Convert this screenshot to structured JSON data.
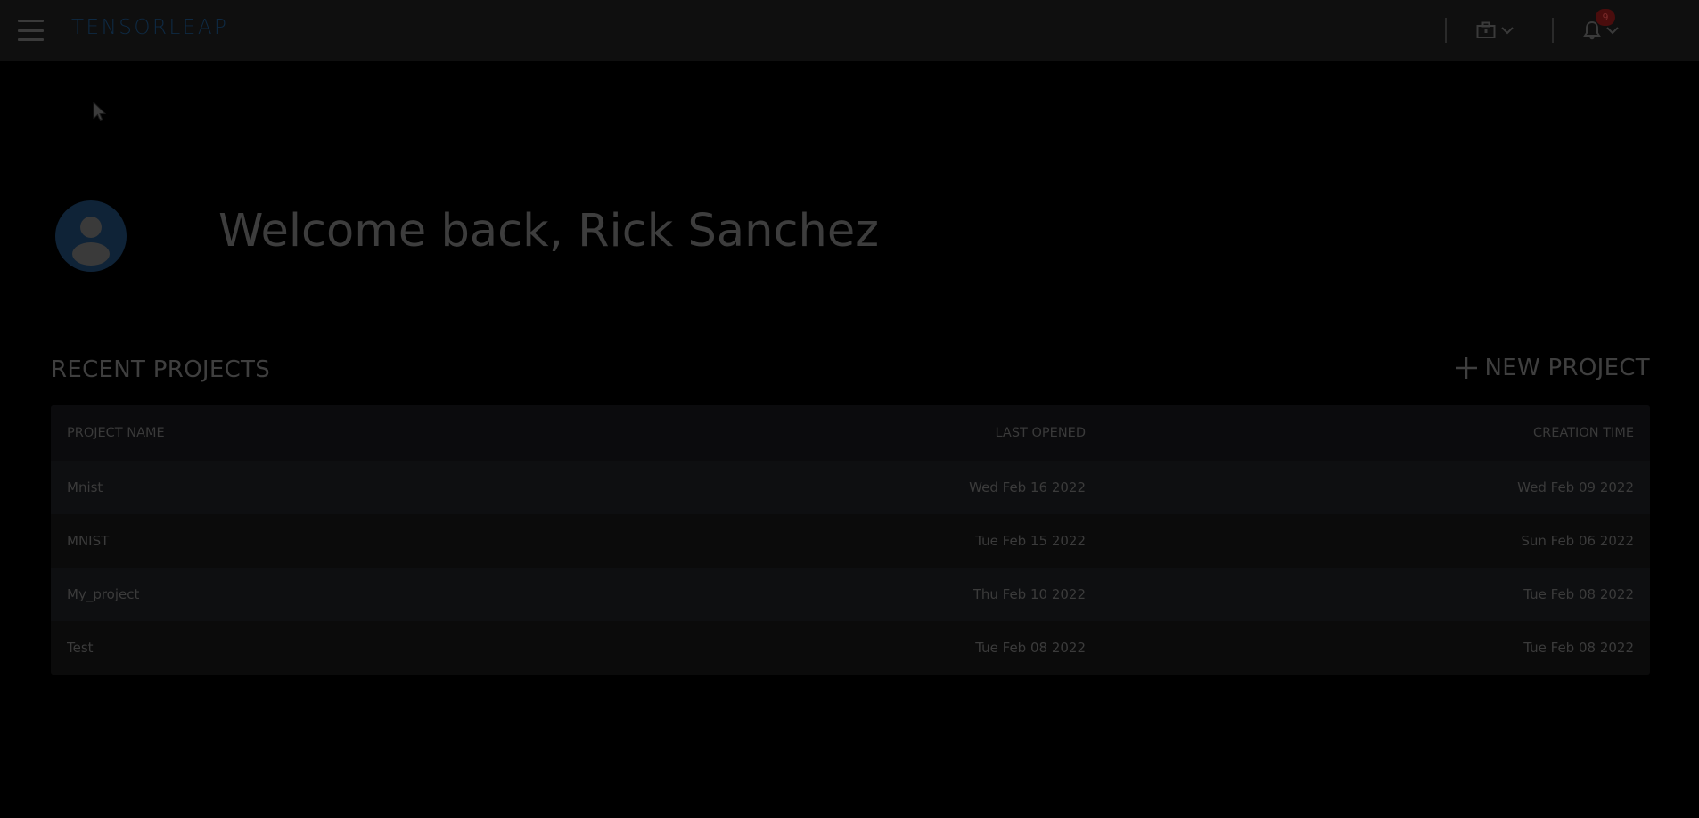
{
  "app": {
    "logo_text": "TENSORLEAP",
    "notification_count": "9",
    "brand_color": "#0e2a44",
    "background_color": "#000000",
    "icons": [
      "menu-icon",
      "briefcase-icon",
      "chevron-down-icon",
      "bell-icon",
      "plus-icon",
      "user-icon",
      "cursor-icon"
    ]
  },
  "welcome": {
    "text": "Welcome back, Rick Sanchez"
  },
  "recent": {
    "title": "RECENT PROJECTS",
    "new_project_label": "NEW PROJECT",
    "columns": {
      "name": "PROJECT NAME",
      "opened": "LAST OPENED",
      "created": "CREATION TIME"
    },
    "rows": [
      {
        "name": "Mnist",
        "opened": "Wed Feb 16 2022",
        "created": "Wed Feb 09 2022"
      },
      {
        "name": "MNIST",
        "opened": "Tue Feb 15 2022",
        "created": "Sun Feb 06 2022"
      },
      {
        "name": "My_project",
        "opened": "Thu Feb 10 2022",
        "created": "Tue Feb 08 2022"
      },
      {
        "name": "Test",
        "opened": "Tue Feb 08 2022",
        "created": "Tue Feb 08 2022"
      }
    ]
  }
}
